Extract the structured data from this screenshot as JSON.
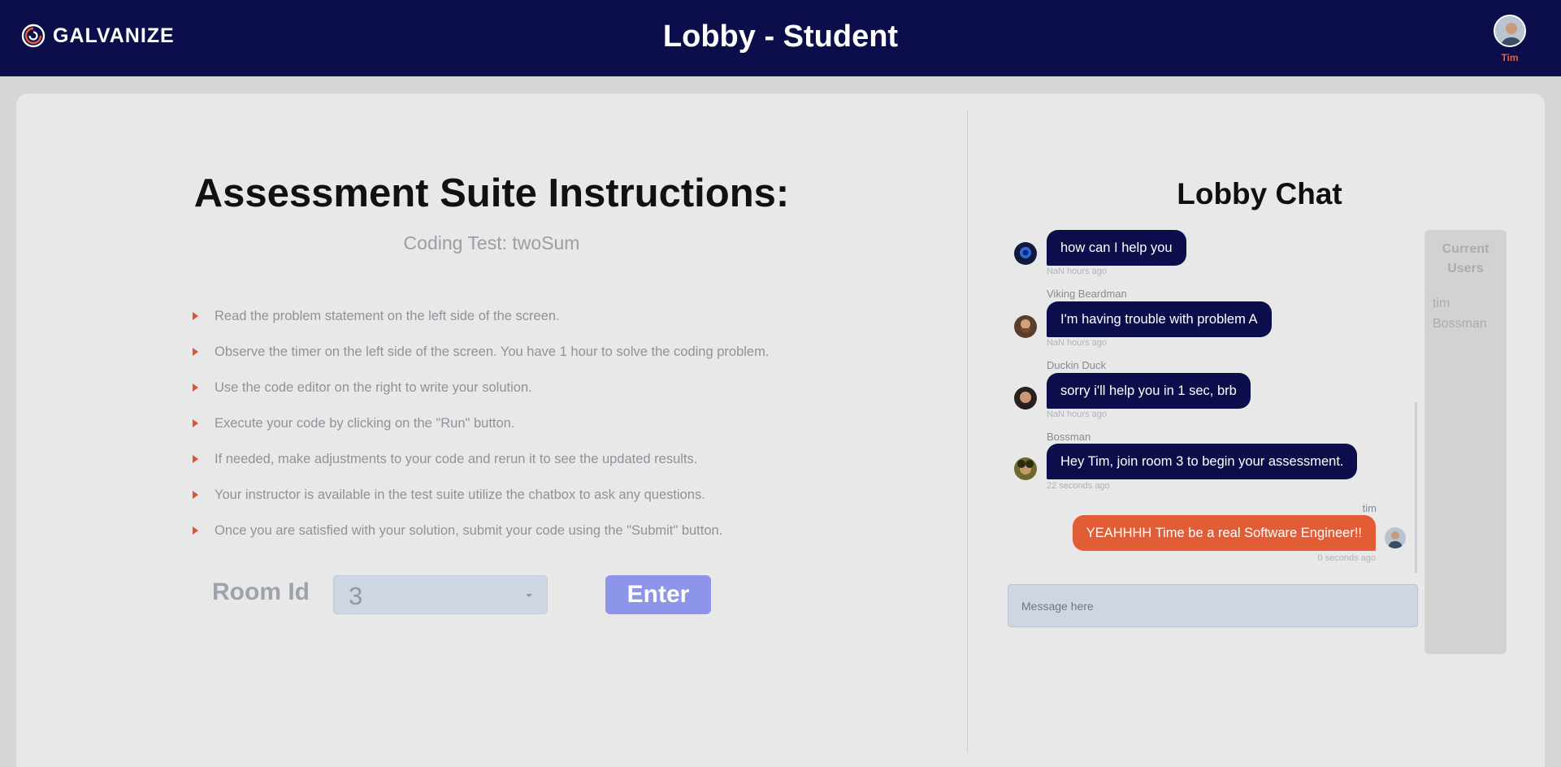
{
  "header": {
    "brand": "GALVANIZE",
    "title": "Lobby - Student",
    "user_name": "Tim"
  },
  "instructions": {
    "title": "Assessment Suite Instructions:",
    "subtitle": "Coding Test: twoSum",
    "steps": [
      "Read the problem statement on the left side of the screen.",
      "Observe the timer on the left side of the screen. You have 1 hour to solve the coding problem.",
      "Use the code editor on the right to write your solution.",
      "Execute your code by clicking on the \"Run\" button.",
      "If needed, make adjustments to your code and rerun it to see the updated results.",
      "Your instructor is available in the test suite utilize the chatbox to ask any questions.",
      "Once you are satisfied with your solution, submit your code using the \"Submit\" button."
    ],
    "room_label": "Room Id",
    "room_value": "3",
    "enter_label": "Enter"
  },
  "chat": {
    "title": "Lobby Chat",
    "messages": [
      {
        "sender": "",
        "text": "how can I help you",
        "time": "NaN hours ago"
      },
      {
        "sender": "Viking Beardman",
        "text": "I'm having trouble with problem A",
        "time": "NaN hours ago"
      },
      {
        "sender": "Duckin Duck",
        "text": "sorry i'll help you in 1 sec, brb",
        "time": "NaN hours ago"
      },
      {
        "sender": "Bossman",
        "text": "Hey Tim, join room 3 to begin your assessment.",
        "time": "22 seconds ago"
      },
      {
        "sender": "tim",
        "text": "YEAHHHH Time be a real Software Engineer!!",
        "time": "0 seconds ago"
      }
    ],
    "input_placeholder": "Message here"
  },
  "users": {
    "title": "Current Users",
    "list": [
      "tim",
      "Bossman"
    ]
  },
  "colors": {
    "navy": "#0b0e4a",
    "accent_orange": "#e25c36",
    "enter_button": "#8c95e8"
  }
}
